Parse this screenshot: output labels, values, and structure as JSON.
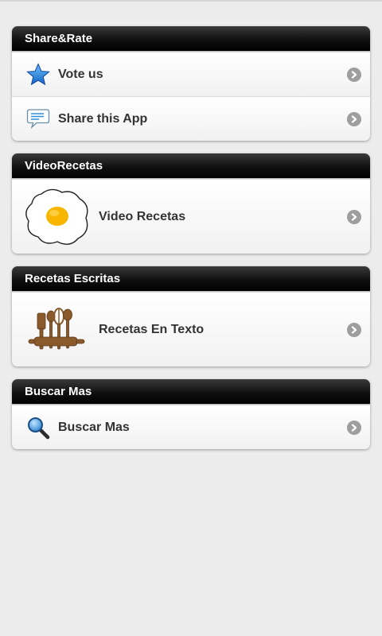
{
  "sections": [
    {
      "header": "Share&Rate",
      "items": [
        {
          "label": "Vote us",
          "icon": "star-icon"
        },
        {
          "label": "Share this App",
          "icon": "speech-bubble-icon"
        }
      ]
    },
    {
      "header": "VideoRecetas",
      "items": [
        {
          "label": "Video Recetas",
          "icon": "fried-egg-icon"
        }
      ]
    },
    {
      "header": "Recetas Escritas",
      "items": [
        {
          "label": "Recetas En Texto",
          "icon": "kitchen-utensils-icon"
        }
      ]
    },
    {
      "header": "Buscar Mas",
      "items": [
        {
          "label": "Buscar Mas",
          "icon": "magnifier-icon"
        }
      ]
    }
  ],
  "colors": {
    "header_bg": "#111111",
    "header_text": "#ffffff",
    "row_text": "#333333",
    "chevron_bg": "#9e9e9e",
    "star_blue": "#1e88e5",
    "egg_yolk": "#f5b400",
    "utensil_brown": "#8b5a2b"
  }
}
